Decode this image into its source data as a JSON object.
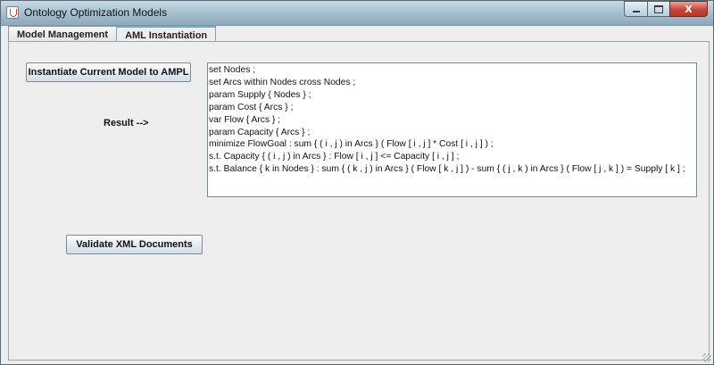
{
  "window": {
    "title": "Ontology Optimization Models",
    "icon": "java-cup-icon",
    "controls": {
      "minimize_icon": "minimize-icon",
      "maximize_icon": "maximize-icon",
      "close_label": "X"
    }
  },
  "tabs": [
    {
      "label": "Model Management",
      "active": false
    },
    {
      "label": "AML Instantiation",
      "active": true
    }
  ],
  "panel": {
    "instantiate_button": "Instantiate Current Model to AMPL",
    "result_label": "Result -->",
    "validate_button": "Validate XML Documents",
    "result_lines": [
      "set Nodes ;",
      "set Arcs within Nodes cross Nodes ;",
      "param Supply { Nodes } ;",
      "param Cost { Arcs } ;",
      "var Flow { Arcs } ;",
      "param Capacity { Arcs } ;",
      "minimize FlowGoal : sum { ( i , j ) in Arcs } ( Flow [ i , j ] * Cost [ i , j ] ) ;",
      "s.t. Capacity { ( i , j ) in Arcs } : Flow [ i , j ] <= Capacity [ i , j ] ;",
      "s.t. Balance { k in Nodes } : sum { ( k , j ) in Arcs } ( Flow [ k , j ] ) - sum { ( j , k ) in Arcs } ( Flow [ j , k ] ) = Supply [ k ] ;"
    ]
  }
}
